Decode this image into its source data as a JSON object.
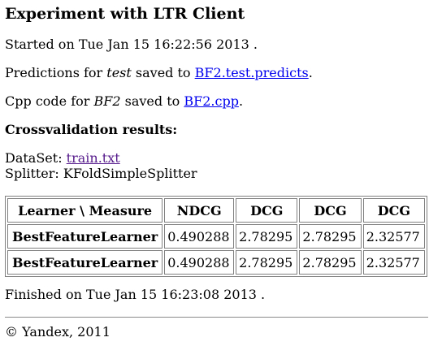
{
  "page": {
    "title": "Experiment with LTR Client",
    "started": "Started on Tue Jan 15 16:22:56 2013 .",
    "predictions_prefix": "Predictions for ",
    "predictions_set": "test",
    "predictions_mid": " saved to ",
    "predictions_link": "BF2.test.predicts",
    "predictions_suffix": ".",
    "cpp_prefix": "Cpp code for ",
    "cpp_model": "BF2",
    "cpp_mid": " saved to ",
    "cpp_link": "BF2.cpp",
    "cpp_suffix": ".",
    "cv_heading": "Crossvalidation results:",
    "dataset_label": "DataSet: ",
    "dataset_link": "train.txt",
    "splitter": "Splitter: KFoldSimpleSplitter",
    "finished": "Finished on Tue Jan 15 16:23:08 2013 .",
    "footer": "© Yandex, 2011"
  },
  "table": {
    "headers": [
      "Learner \\ Measure",
      "NDCG",
      "DCG",
      "DCG",
      "DCG"
    ],
    "rows": [
      [
        "BestFeatureLearner",
        "0.490288",
        "2.78295",
        "2.78295",
        "2.32577"
      ],
      [
        "BestFeatureLearner",
        "0.490288",
        "2.78295",
        "2.78295",
        "2.32577"
      ]
    ]
  }
}
